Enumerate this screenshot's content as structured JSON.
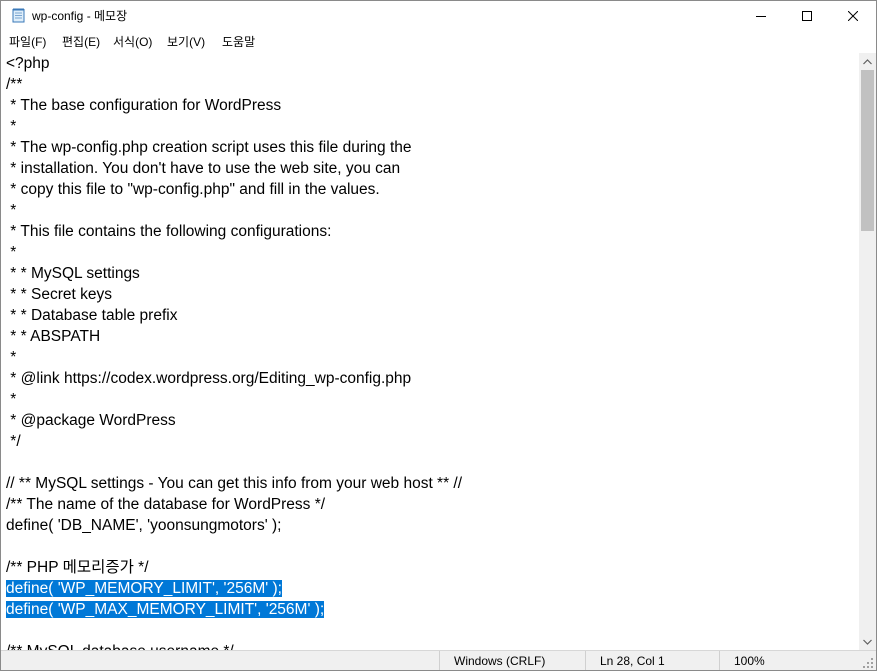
{
  "window": {
    "title": "wp-config - 메모장"
  },
  "menu": [
    {
      "label": "파일(F)"
    },
    {
      "label": "편집(E)"
    },
    {
      "label": "서식(O)"
    },
    {
      "label": "보기(V)"
    },
    {
      "label": "도움말"
    }
  ],
  "editor": {
    "lines": [
      "<?php",
      "/**",
      " * The base configuration for WordPress",
      " *",
      " * The wp-config.php creation script uses this file during the",
      " * installation. You don't have to use the web site, you can",
      " * copy this file to \"wp-config.php\" and fill in the values.",
      " *",
      " * This file contains the following configurations:",
      " *",
      " * * MySQL settings",
      " * * Secret keys",
      " * * Database table prefix",
      " * * ABSPATH",
      " *",
      " * @link https://codex.wordpress.org/Editing_wp-config.php",
      " *",
      " * @package WordPress",
      " */",
      "",
      "// ** MySQL settings - You can get this info from your web host ** //",
      "/** The name of the database for WordPress */",
      "define( 'DB_NAME', 'yoonsungmotors' );",
      "",
      "/** PHP 메모리증가 */",
      "define( 'WP_MEMORY_LIMIT', '256M' );",
      "define( 'WP_MAX_MEMORY_LIMIT', '256M' );",
      "",
      "/** MySQL database username */"
    ],
    "selected_lines": [
      25,
      26
    ]
  },
  "status": {
    "encoding": "Windows (CRLF)",
    "position": "Ln 28, Col 1",
    "zoom": "100%"
  },
  "colors": {
    "selection": "#0078d7",
    "selection_text": "#ffffff",
    "scroll_thumb": "#c1c1c1"
  }
}
